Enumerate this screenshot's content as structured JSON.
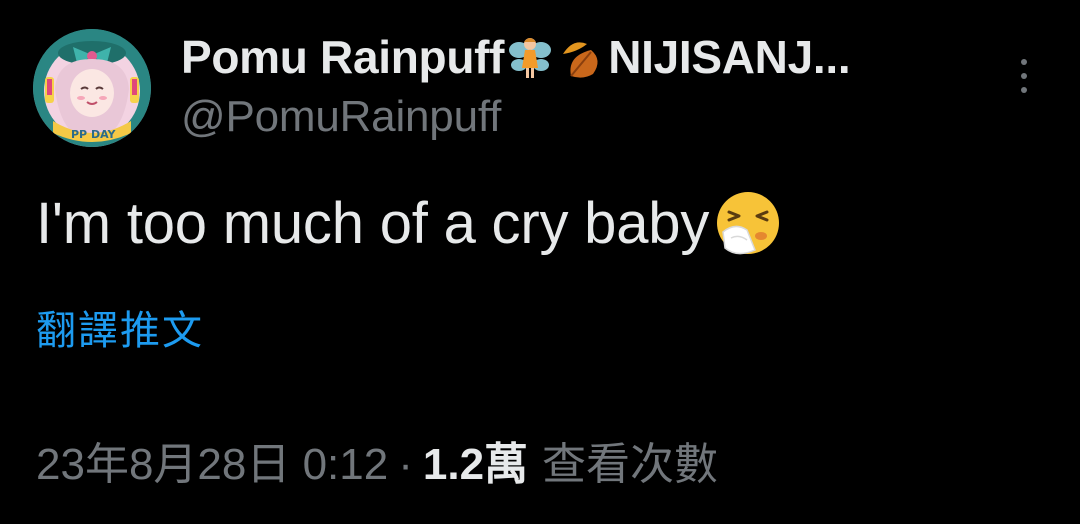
{
  "author": {
    "display_name": "Pomu Rainpuff",
    "name_suffix": "NIJISANJ...",
    "name_emojis": [
      "fairy-emoji",
      "fallen-leaf-emoji"
    ],
    "handle": "@PomuRainpuff"
  },
  "tweet": {
    "text": "I'm too much of a cry baby",
    "trailing_emoji": "sneezing-face-emoji",
    "translate_label": "翻譯推文"
  },
  "meta": {
    "timestamp": "23年8月28日 0:12",
    "separator": "·",
    "views_count": "1.2萬",
    "views_label": "查看次數"
  },
  "colors": {
    "background": "#000000",
    "primary_text": "#e7e9ea",
    "secondary_text": "#71767b",
    "link": "#1d9bf0"
  }
}
